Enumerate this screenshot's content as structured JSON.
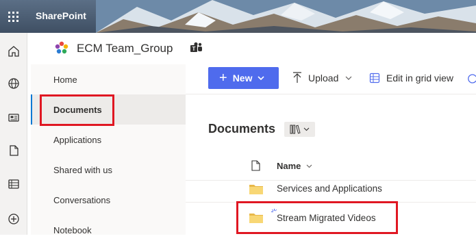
{
  "suite": {
    "app_name": "SharePoint"
  },
  "site": {
    "title": "ECM Team_Group"
  },
  "nav": {
    "items": [
      {
        "label": "Home",
        "selected": false
      },
      {
        "label": "Documents",
        "selected": true
      },
      {
        "label": "Applications",
        "selected": false
      },
      {
        "label": "Shared with us",
        "selected": false
      },
      {
        "label": "Conversations",
        "selected": false
      },
      {
        "label": "Notebook",
        "selected": false
      }
    ]
  },
  "commands": {
    "new_label": "New",
    "upload_label": "Upload",
    "grid_label": "Edit in grid view"
  },
  "library": {
    "title": "Documents",
    "columns": {
      "name": "Name"
    },
    "rows": [
      {
        "name": "Services and Applications",
        "type": "folder"
      },
      {
        "name": "Stream Migrated Videos",
        "type": "folder",
        "new": true
      }
    ]
  },
  "colors": {
    "accent": "#4f6bed",
    "selection": "#0078d4",
    "callout": "#e01722",
    "folder": "#f8d775"
  },
  "icons": [
    "waffle-icon",
    "home-icon",
    "globe-icon",
    "news-icon",
    "file-icon",
    "list-icon",
    "add-icon",
    "teams-icon",
    "upload-icon",
    "grid-icon",
    "library-views-icon",
    "document-type-icon",
    "folder-icon"
  ]
}
